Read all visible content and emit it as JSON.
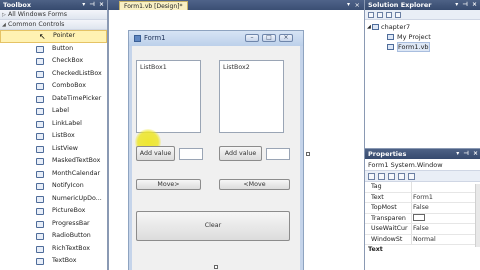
{
  "toolbox": {
    "title": "Toolbox",
    "all_forms_group": "All Windows Forms",
    "common_group": "Common Controls",
    "items": [
      {
        "label": "Pointer",
        "icon": "pointer-icon"
      },
      {
        "label": "Button",
        "icon": "button-icon"
      },
      {
        "label": "CheckBox",
        "icon": "checkbox-icon"
      },
      {
        "label": "CheckedListBox",
        "icon": "checkedlistbox-icon"
      },
      {
        "label": "ComboBox",
        "icon": "combobox-icon"
      },
      {
        "label": "DateTimePicker",
        "icon": "datetimepicker-icon"
      },
      {
        "label": "Label",
        "icon": "label-icon"
      },
      {
        "label": "LinkLabel",
        "icon": "linklabel-icon"
      },
      {
        "label": "ListBox",
        "icon": "listbox-icon"
      },
      {
        "label": "ListView",
        "icon": "listview-icon"
      },
      {
        "label": "MaskedTextBox",
        "icon": "maskedtextbox-icon"
      },
      {
        "label": "MonthCalendar",
        "icon": "monthcalendar-icon"
      },
      {
        "label": "NotifyIcon",
        "icon": "notifyicon-icon"
      },
      {
        "label": "NumericUpDo...",
        "icon": "numericupdown-icon"
      },
      {
        "label": "PictureBox",
        "icon": "picturebox-icon"
      },
      {
        "label": "ProgressBar",
        "icon": "progressbar-icon"
      },
      {
        "label": "RadioButton",
        "icon": "radiobutton-icon"
      },
      {
        "label": "RichTextBox",
        "icon": "richtextbox-icon"
      },
      {
        "label": "TextBox",
        "icon": "textbox-icon"
      }
    ]
  },
  "designer": {
    "tab_label": "Form1.vb [Design]*",
    "close_glyph": "×",
    "pin_glyph": "▾",
    "form_title": "Form1",
    "listbox1": "ListBox1",
    "listbox2": "ListBox2",
    "add_value_left": "Add value",
    "add_value_right": "Add value",
    "move_right": "Move>",
    "move_left": "<Move",
    "clear": "Clear"
  },
  "solution_explorer": {
    "title": "Solution Explorer",
    "project": "chapter7",
    "my_project": "My Project",
    "form_file": "Form1.vb"
  },
  "properties": {
    "title": "Properties",
    "target": "Form1  System.Window",
    "rows": [
      {
        "name": "Tag",
        "value": ""
      },
      {
        "name": "Text",
        "value": "Form1"
      },
      {
        "name": "TopMost",
        "value": "False"
      },
      {
        "name": "Transparen",
        "value": ""
      },
      {
        "name": "UseWaitCur",
        "value": "False"
      },
      {
        "name": "WindowSt",
        "value": "Normal"
      }
    ],
    "footer": "Text"
  },
  "colors": {
    "title_bar": "#3b4f74",
    "selected_tool": "#fff2b3",
    "highlight": "#eee628",
    "form_bg": "#f0f0f0"
  }
}
